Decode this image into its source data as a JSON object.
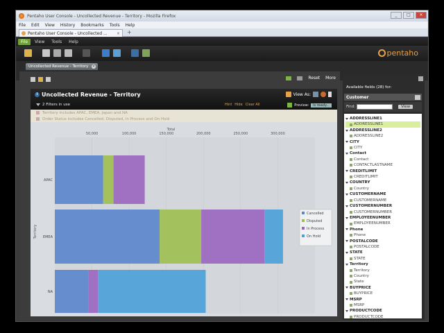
{
  "browser": {
    "window_title": "Pentaho User Console - Uncollected Revenue - Territory - Mozilla Firefox",
    "menu": [
      "File",
      "Edit",
      "View",
      "History",
      "Bookmarks",
      "Tools",
      "Help"
    ],
    "tab_label": "Pentaho User Console - Uncollected ..."
  },
  "app": {
    "menu": [
      "File",
      "View",
      "Tools",
      "Help"
    ],
    "logo_text": "pentaho",
    "doc_tab": "Uncollected Revenue - Territory",
    "reset_label": "Reset",
    "more_label": "More"
  },
  "report": {
    "title": "Uncollected Revenue - Territory",
    "view_as": "View As:",
    "filters_in_use": "2 Filters in use",
    "filter_links": [
      "Hint",
      "Hide",
      "Clear All"
    ],
    "status_label": "Preview:",
    "status_value": "is ready...",
    "filters": [
      "Territory includes APAC, EMEA, Japan and NA",
      "Order Status includes Cancelled, Disputed, In Process and On Hold"
    ]
  },
  "chart_data": {
    "type": "bar",
    "orientation": "horizontal",
    "stacked": true,
    "xlabel": "Total",
    "ylabel": "Territory",
    "x_ticks": [
      "50,000",
      "100,000",
      "150,000",
      "200,000",
      "250,000",
      "300,000"
    ],
    "xlim": [
      0,
      350000
    ],
    "categories": [
      "APAC",
      "EMEA",
      "NA"
    ],
    "series": [
      {
        "name": "Cancelled",
        "color": "#5a86cc",
        "values": [
          65000,
          141000,
          45000
        ]
      },
      {
        "name": "Disputed",
        "color": "#9dbf4f",
        "values": [
          14000,
          56000,
          0
        ]
      },
      {
        "name": "In Process",
        "color": "#9a66c0",
        "values": [
          42000,
          85000,
          13000
        ]
      },
      {
        "name": "On Hold",
        "color": "#4aa0d8",
        "values": [
          0,
          25000,
          145000
        ]
      }
    ],
    "legend_position": "right"
  },
  "fields": {
    "header": "Available fields (28) for:",
    "customer": "Customer",
    "find_label": "Find:",
    "view_btn": "View",
    "groups": [
      {
        "name": "ADDRESSLINE1",
        "items": [
          "ADDRESSLINE1"
        ]
      },
      {
        "name": "ADDRESSLINE2",
        "items": [
          "ADDRESSLINE2"
        ]
      },
      {
        "name": "CITY",
        "items": [
          "CITY"
        ]
      },
      {
        "name": "Contact",
        "items": [
          "Contact",
          "CONTACTLASTNAME"
        ]
      },
      {
        "name": "CREDITLIMIT",
        "items": [
          "CREDITLIMIT"
        ]
      },
      {
        "name": "COUNTRY",
        "items": [
          "Country"
        ]
      },
      {
        "name": "CUSTOMERNAME",
        "items": [
          "CUSTOMERNAME"
        ]
      },
      {
        "name": "CUSTOMERNUMBER",
        "items": [
          "CUSTOMERNUMBER"
        ]
      },
      {
        "name": "EMPLOYEENUMBER",
        "items": [
          "EMPLOYEENUMBER"
        ]
      },
      {
        "name": "Phone",
        "items": [
          "Phone"
        ]
      },
      {
        "name": "POSTALCODE",
        "items": [
          "POSTALCODE"
        ]
      },
      {
        "name": "STATE",
        "items": [
          "STATE"
        ]
      },
      {
        "name": "Territory",
        "items": [
          "Territory",
          "Country",
          "State"
        ]
      },
      {
        "name": "BUYPRICE",
        "items": [
          "BUYPRICE"
        ]
      },
      {
        "name": "MSRP",
        "items": [
          "MSRP"
        ]
      },
      {
        "name": "PRODUCTCODE",
        "items": [
          "PRODUCTCODE"
        ]
      }
    ]
  }
}
